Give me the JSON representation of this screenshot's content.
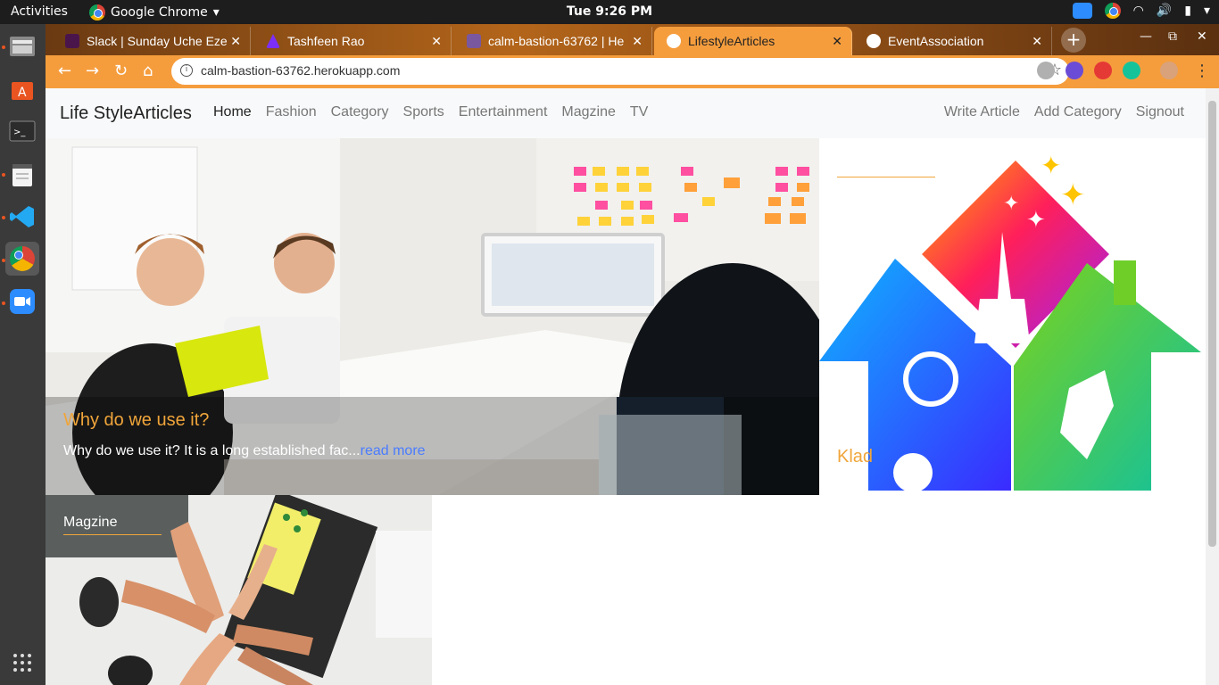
{
  "system": {
    "activities": "Activities",
    "app_name": "Google Chrome",
    "clock": "Tue  9:26 PM"
  },
  "browser": {
    "tabs": [
      {
        "label": "Slack | Sunday Uche Eze",
        "color": "#4a154b"
      },
      {
        "label": "Tashfeen Rao",
        "color": "#7b2ff7"
      },
      {
        "label": "calm-bastion-63762 | He",
        "color": "#79589f"
      },
      {
        "label": "LifestyleArticles",
        "color": "#ffffff"
      },
      {
        "label": "EventAssociation",
        "color": "#ffffff"
      }
    ],
    "url": "calm-bastion-63762.herokuapp.com",
    "accent": "#f59d3d"
  },
  "site": {
    "brand": "Life StyleArticles",
    "nav_left": [
      "Home",
      "Fashion",
      "Category",
      "Sports",
      "Entertainment",
      "Magzine",
      "TV"
    ],
    "nav_right": [
      "Write Article",
      "Add Category",
      "Signout"
    ],
    "hero": {
      "title": "Why do we use it?",
      "excerpt": "Why do we use it? It is a long established fac...",
      "read_more": "read more"
    },
    "side": {
      "title": "Klad"
    },
    "card": {
      "category": "Magzine"
    },
    "accent": "#f0a53a"
  }
}
